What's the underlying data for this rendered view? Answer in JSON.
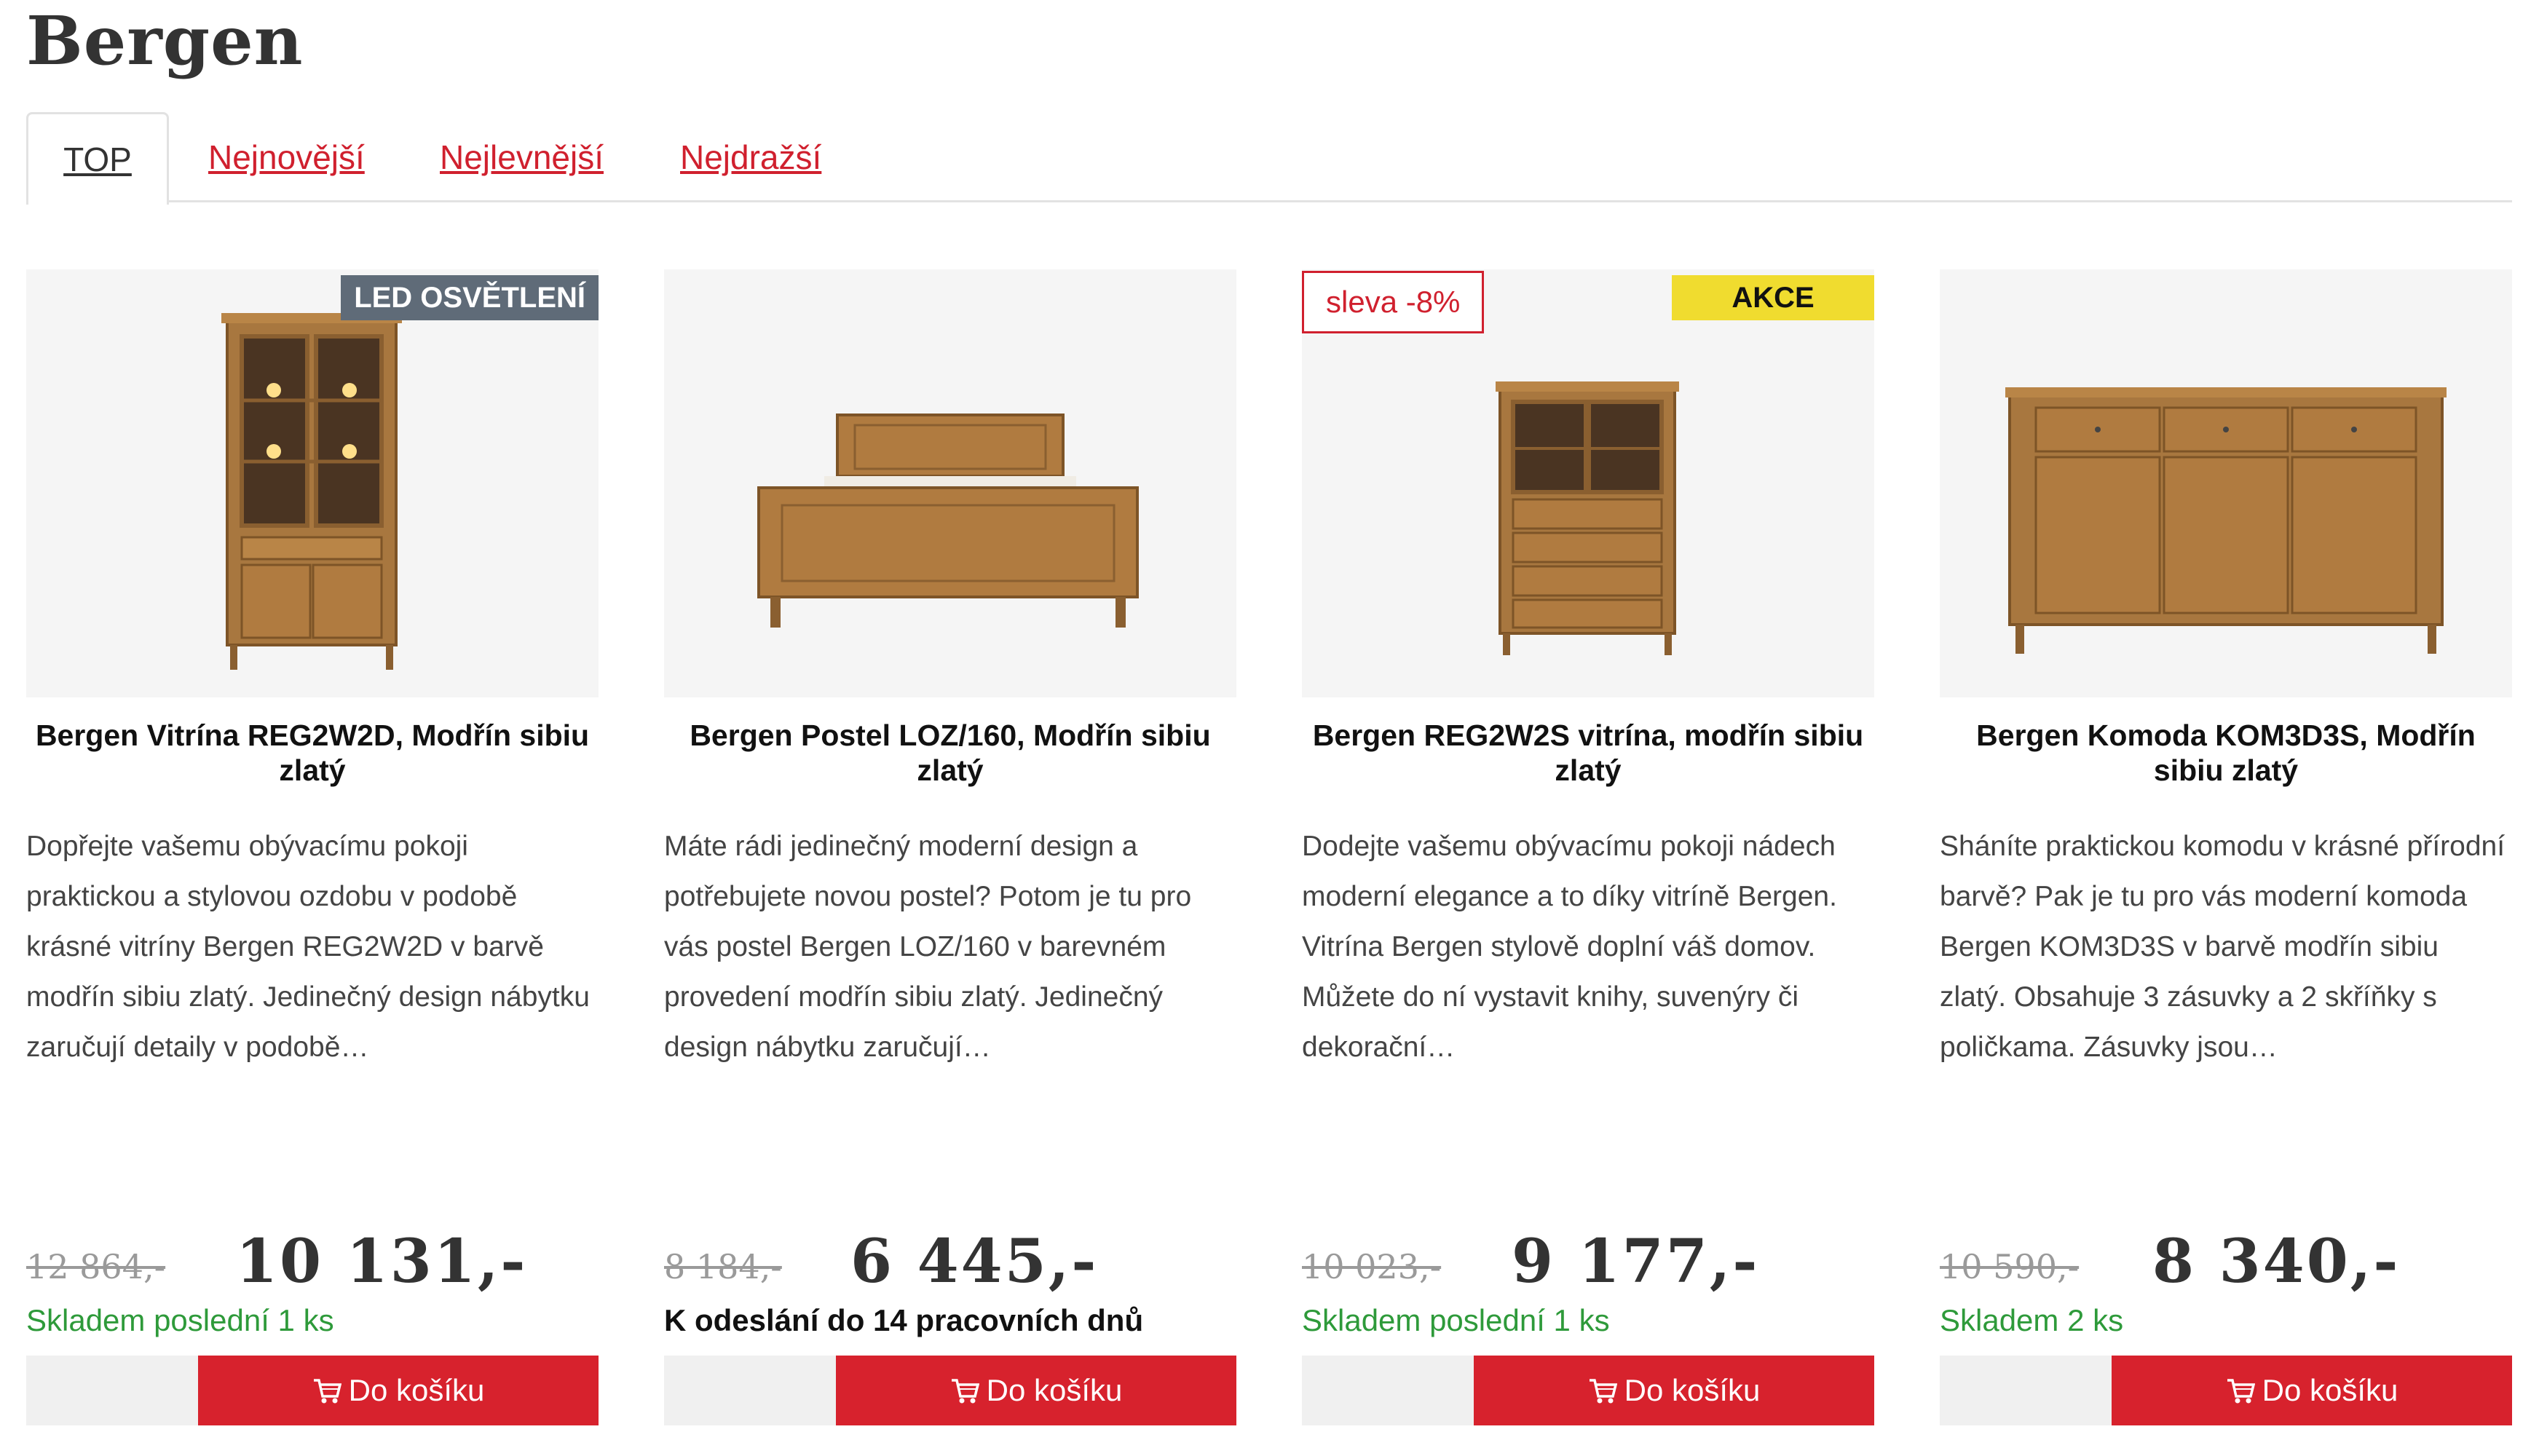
{
  "page": {
    "title": "Bergen"
  },
  "tabs": [
    {
      "label": "TOP"
    },
    {
      "label": "Nejnovější"
    },
    {
      "label": "Nejlevnější"
    },
    {
      "label": "Nejdražší"
    }
  ],
  "colors": {
    "accent_red": "#d7222d",
    "stock_green": "#2e9a3a",
    "akce_yellow": "#f0dc2f",
    "led_badge": "#5f6b78"
  },
  "products": [
    {
      "badge": "LED OSVĚTLENÍ",
      "title": "Bergen Vitrína REG2W2D, Modřín sibiu zlatý",
      "description": "Dopřejte vašemu obývacímu pokoji praktickou a stylovou ozdobu v podobě krásné vitríny Bergen REG2W2D v barvě modřín sibiu zlatý. Jedinečný design nábytku zaručují detaily v podobě…",
      "old_price": "12 864,-",
      "price": "10 131,-",
      "stock": "Skladem poslední 1 ks",
      "cart_label": "Do košíku"
    },
    {
      "title": "Bergen Postel LOZ/160, Modřín sibiu zlatý",
      "description": "Máte rádi jedinečný moderní design a potřebujete novou postel? Potom je tu pro vás postel Bergen LOZ/160 v barevném provedení modřín sibiu zlatý. Jedinečný design nábytku zaručují…",
      "old_price": "8 184,-",
      "price": "6 445,-",
      "stock": "K odeslání do 14 pracovních dnů",
      "cart_label": "Do košíku"
    },
    {
      "sleva": "sleva -8%",
      "badge": "AKCE",
      "title": "Bergen REG2W2S vitrína, modřín sibiu zlatý",
      "description": "Dodejte vašemu obývacímu pokoji nádech moderní elegance a to díky vitríně Bergen. Vitrína Bergen stylově doplní váš domov. Můžete do ní vystavit knihy, suvenýry či dekorační…",
      "old_price": "10 023,-",
      "price": "9 177,-",
      "stock": "Skladem poslední 1 ks",
      "cart_label": "Do košíku"
    },
    {
      "title": "Bergen Komoda KOM3D3S, Modřín sibiu zlatý",
      "description": "Sháníte praktickou komodu v krásné přírodní barvě? Pak je tu pro vás moderní komoda Bergen KOM3D3S v barvě modřín sibiu zlatý. Obsahuje 3 zásuvky a 2 skříňky s poličkama. Zásuvky jsou…",
      "old_price": "10 590,-",
      "price": "8 340,-",
      "stock": "Skladem 2 ks",
      "cart_label": "Do košíku"
    }
  ]
}
